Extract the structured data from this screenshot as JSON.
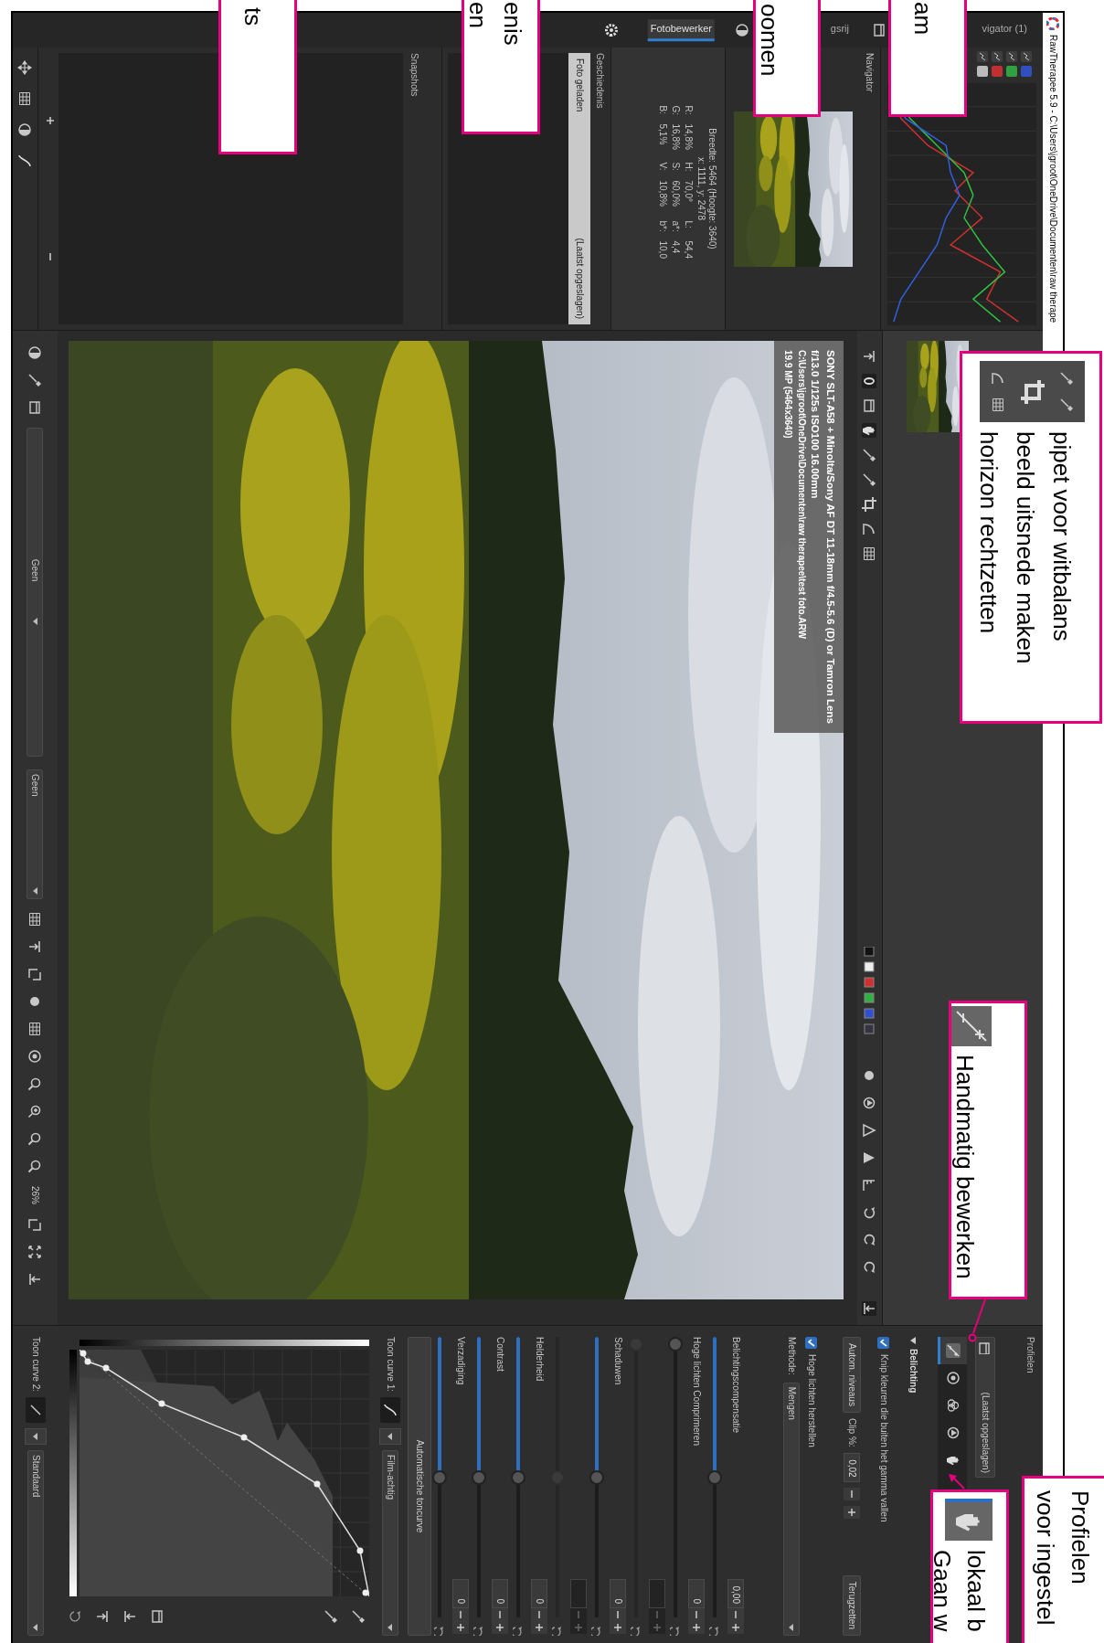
{
  "window": {
    "title": "RawTherapee 5.9 - C:\\Users\\jgroot\\OneDrive\\Documenten\\raw therape"
  },
  "tabs": [
    {
      "label": "Fotobewerker",
      "selected": true
    },
    {
      "label": "gsrij",
      "selected": false
    },
    {
      "label": "vigator (1)",
      "selected": false
    }
  ],
  "navigator": {
    "title": "Navigator"
  },
  "info": {
    "size": "Breedte: 5464 (Hoogte: 3640)",
    "position": "x: 1111, y: 2478",
    "readouts": {
      "r": {
        "label": "R:",
        "value": "14,8%"
      },
      "g": {
        "label": "G:",
        "value": "16,8%"
      },
      "b": {
        "label": "B:",
        "value": "5,1%"
      },
      "h": {
        "label": "H:",
        "value": "70,0°"
      },
      "s": {
        "label": "S:",
        "value": "60,0%"
      },
      "v": {
        "label": "V:",
        "value": "10,8%"
      },
      "l": {
        "label": "L:",
        "value": "54,4"
      },
      "a_star": {
        "label": "a*:",
        "value": "4,4"
      },
      "b_star": {
        "label": "b*:",
        "value": "10,0"
      }
    }
  },
  "history": {
    "title": "Geschiedenis",
    "rows": [
      {
        "action": "Foto geladen",
        "note": "(Laatst opgeslagen)",
        "selected": true
      }
    ]
  },
  "snapshots": {
    "title": "Snapshots"
  },
  "photo_info": [
    "SONY SLT-A58 + Minolta/Sony AF DT 11-18mm f/4.5-5.6 (D) or Tamron Lens",
    "f/13.0 1/125s ISO100 16.00mm",
    "C:\\Users\\jgroot\\OneDrive\\Documenten\\raw therapee\\test foto.ARW",
    "19.9 MP (5464x3640)"
  ],
  "viewer_toolbar": {
    "combos": [
      "Geen",
      "Geen"
    ],
    "zoom": "26%"
  },
  "profiles": {
    "label": "Profielen",
    "value": "(Laatst opgeslagen)"
  },
  "tool_tabs": [
    {
      "selected": true
    },
    {
      "selected": false
    },
    {
      "selected": false
    },
    {
      "selected": false
    },
    {
      "selected": false
    }
  ],
  "exposure": {
    "title": "Belichting",
    "expanded": true,
    "clip_check": {
      "label": "Knip kleuren die buiten het gamma vallen",
      "checked": true
    },
    "auto_button": "Autom. niveaus",
    "clip_label": "Clip %:",
    "clip_value": "0,02",
    "reset_button": "Terugzetten",
    "highlight_check": {
      "label": "Hoge lichten herstellen",
      "checked": true
    },
    "method_label": "Methode:",
    "method_value": "Mengen",
    "sliders": [
      {
        "label": "Belichtingscompensatie",
        "value": "0,00",
        "level": 0.5,
        "disabled": false
      },
      {
        "label": "Hoge lichten Comprimeren",
        "value": "0",
        "level": 0,
        "disabled": false
      },
      {
        "level": 0,
        "disabled": true
      },
      {
        "label": "Schaduwen",
        "value": "0",
        "level": 0.5,
        "disabled": false
      },
      {
        "level": 0.5,
        "disabled": true
      },
      {
        "label": "Helderheid",
        "value": "0",
        "level": 0.5,
        "disabled": false
      },
      {
        "label": "Contrast",
        "value": "0",
        "level": 0.5,
        "disabled": false
      },
      {
        "label": "Verzadiging",
        "value": "0",
        "level": 0.5,
        "disabled": false
      }
    ],
    "auto_tone_button": "Automatische toncurve",
    "curve1": {
      "label": "Toon curve 1:",
      "type": "Film-achtig"
    },
    "curve2": {
      "label": "Toon curve 2:",
      "type": "Standaard"
    }
  },
  "annotations": [
    {
      "kind": "text",
      "lines": [
        "am"
      ]
    },
    {
      "kind": "text",
      "lines": [
        "oomen"
      ]
    },
    {
      "kind": "text",
      "lines": [
        "enis",
        "en"
      ]
    },
    {
      "kind": "text",
      "lines": [
        "ts"
      ]
    },
    {
      "kind": "tools",
      "lines": [
        "pipet voor witbalans",
        "beeld uitsnede maken",
        "horizon rechtzetten"
      ]
    },
    {
      "kind": "exposure",
      "lines": [
        "Handmatig bewerken"
      ]
    },
    {
      "kind": "text",
      "lines": [
        "Profielen",
        "voor ingestel"
      ]
    },
    {
      "kind": "hand",
      "lines": [
        "lokaal b",
        "Gaan w"
      ]
    }
  ]
}
